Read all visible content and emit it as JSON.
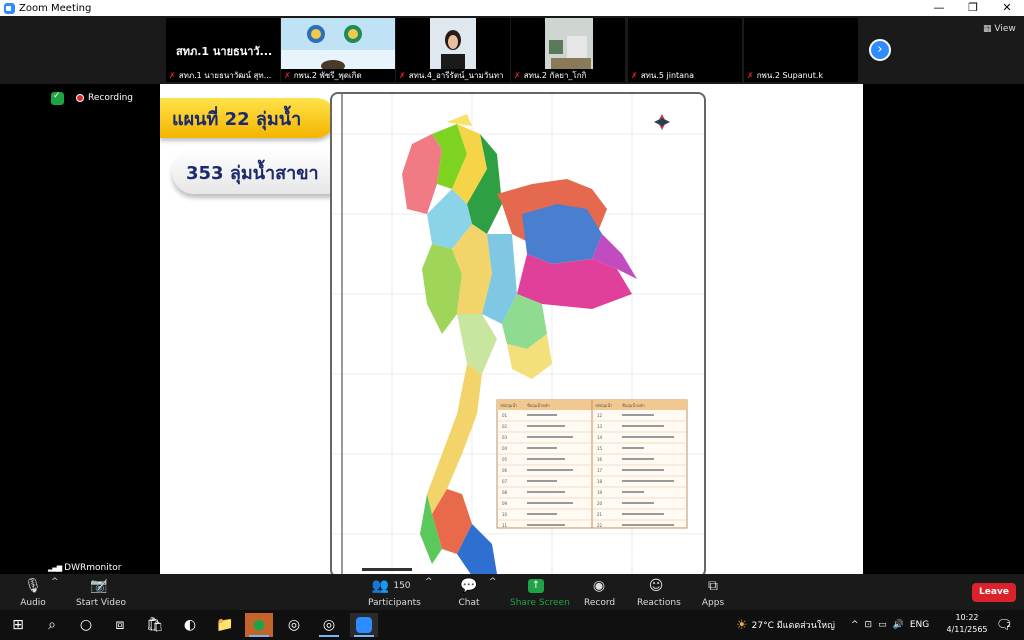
{
  "window": {
    "title": "Zoom Meeting",
    "minimize": "—",
    "restore": "❐",
    "close": "✕"
  },
  "strip": {
    "tiles": [
      {
        "big_name": "สทภ.1 นายธนาวั...",
        "label": "สทภ.1 นายธนาวัฒน์ สุท..."
      },
      {
        "label": "กพน.2 พัชรี_พุดเกิด"
      },
      {
        "label": "สทน.4_อารีรัตน์_นามวันทา"
      },
      {
        "label": "สทน.2 กัลยา_โกกิ"
      },
      {
        "label": "สทน.5 jintana"
      },
      {
        "label": "กพน.2 Supanut.k"
      }
    ],
    "next_icon": "›",
    "view_label": "View"
  },
  "stage": {
    "recording_label": "Recording",
    "host_label": "DWRmonitor"
  },
  "slide": {
    "heading": "แผนที่ 22 ลุ่มน้ำ",
    "subheading": "353 ลุ่มน้ำสาขา",
    "legend_headers": [
      "รหัสลุ่มน้ำ",
      "ชื่อลุ่มน้ำหลัก",
      "รหัสลุ่มน้ำ",
      "ชื่อลุ่มน้ำหลัก"
    ],
    "legend_left_codes": [
      "01",
      "02",
      "03",
      "04",
      "05",
      "06",
      "07",
      "08",
      "09",
      "10",
      "11"
    ],
    "legend_right_codes": [
      "12",
      "13",
      "14",
      "15",
      "16",
      "17",
      "18",
      "19",
      "20",
      "21",
      "22"
    ]
  },
  "controls": {
    "audio": "Audio",
    "start_video": "Start Video",
    "participants": "Participants",
    "participants_count": "150",
    "chat": "Chat",
    "share_screen": "Share Screen",
    "record": "Record",
    "reactions": "Reactions",
    "apps": "Apps",
    "leave": "Leave",
    "mic_badge": "!"
  },
  "taskbar": {
    "weather": "27°C มีแดดส่วนใหญ่",
    "language": "ENG",
    "time": "10:22",
    "date": "4/11/2565",
    "notification_count": "2"
  },
  "colors": {
    "zoom_blue": "#2d8cff",
    "share_green": "#1ea446",
    "leave_red": "#d9222a",
    "slide_yellow": "#f3b400",
    "slide_text": "#1a2a6c"
  }
}
